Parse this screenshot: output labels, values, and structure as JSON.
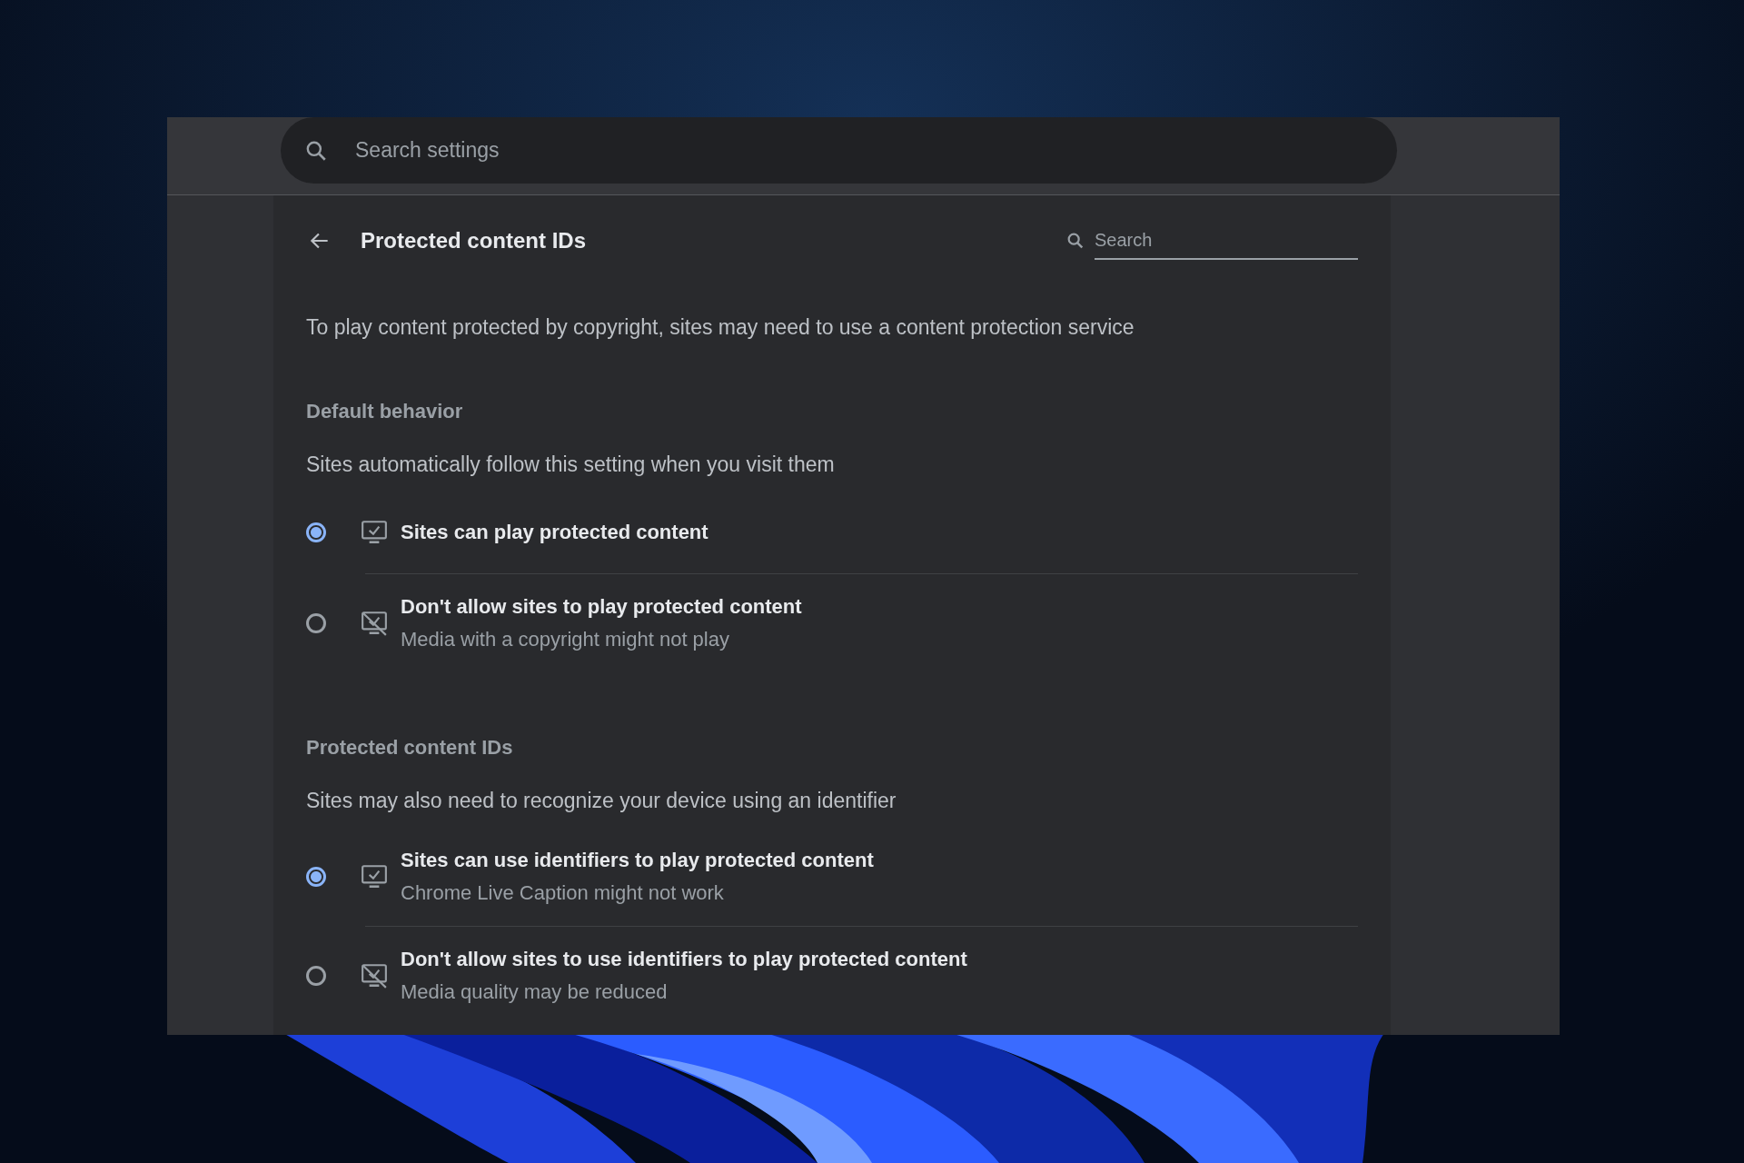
{
  "search_settings": {
    "placeholder": "Search settings"
  },
  "page": {
    "title": "Protected content IDs",
    "search": {
      "placeholder": "Search"
    }
  },
  "description": "To play content protected by copyright, sites may need to use a content protection service",
  "sections": [
    {
      "heading": "Default behavior",
      "subtitle": "Sites automatically follow this setting when you visit them",
      "options": [
        {
          "kind": "allow",
          "label": "Sites can play protected content",
          "selected": true
        },
        {
          "kind": "block",
          "label": "Don't allow sites to play protected content",
          "sublabel": "Media with a copyright might not play",
          "selected": false
        }
      ]
    },
    {
      "heading": "Protected content IDs",
      "subtitle": "Sites may also need to recognize your device using an identifier",
      "options": [
        {
          "kind": "allow",
          "label": "Sites can use identifiers to play protected content",
          "sublabel": "Chrome Live Caption might not work",
          "selected": true
        },
        {
          "kind": "block",
          "label": "Don't allow sites to use identifiers to play protected content",
          "sublabel": "Media quality may be reduced",
          "selected": false
        }
      ]
    }
  ]
}
